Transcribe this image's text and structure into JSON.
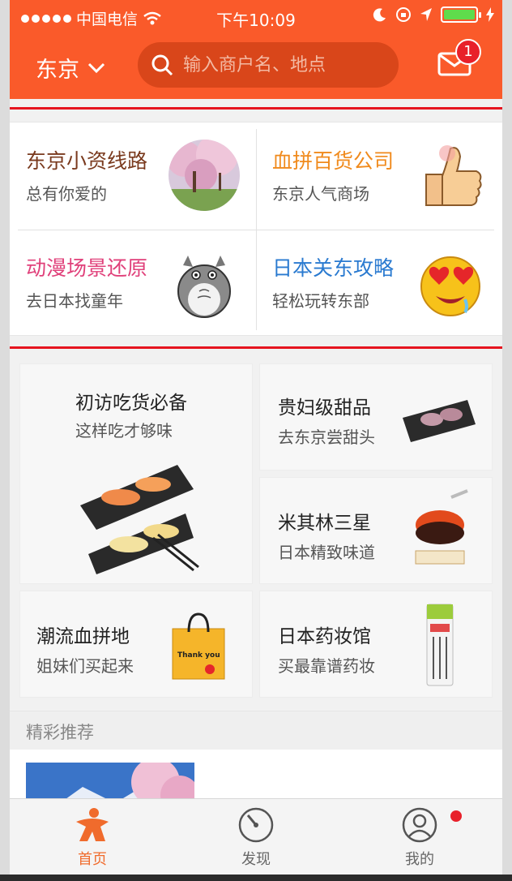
{
  "status_bar": {
    "carrier": "中国电信",
    "time": "下午10:09",
    "battery_level": 1.0
  },
  "header": {
    "city": "东京",
    "search_placeholder": "输入商户名、地点",
    "message_badge": "1"
  },
  "featured": [
    {
      "title": "东京小资线路",
      "subtitle": "总有你爱的",
      "title_color": "#7a3a1e"
    },
    {
      "title": "血拼百货公司",
      "subtitle": "东京人气商场",
      "title_color": "#f08a1c"
    },
    {
      "title": "动漫场景还原",
      "subtitle": "去日本找童年",
      "title_color": "#e0407a"
    },
    {
      "title": "日本关东攻略",
      "subtitle": "轻松玩转东部",
      "title_color": "#2a7ad0"
    }
  ],
  "food_tiles": [
    {
      "title": "初访吃货必备",
      "subtitle": "这样吃才够味"
    },
    {
      "title": "贵妇级甜品",
      "subtitle": "去东京尝甜头"
    },
    {
      "title": "米其林三星",
      "subtitle": "日本精致味道"
    },
    {
      "title": "潮流血拼地",
      "subtitle": "姐妹们买起来"
    },
    {
      "title": "日本药妆馆",
      "subtitle": "买最靠谱药妆"
    }
  ],
  "bag_text": "Thank you",
  "recommend": {
    "header": "精彩推荐"
  },
  "tabs": [
    {
      "label": "首页",
      "icon": "home-icon",
      "active": true
    },
    {
      "label": "发现",
      "icon": "compass-icon",
      "active": false
    },
    {
      "label": "我的",
      "icon": "profile-icon",
      "active": false
    }
  ],
  "colors": {
    "brand": "#fa5a2a",
    "highlight_border": "#e6141f",
    "active_tab": "#f06b2c"
  }
}
